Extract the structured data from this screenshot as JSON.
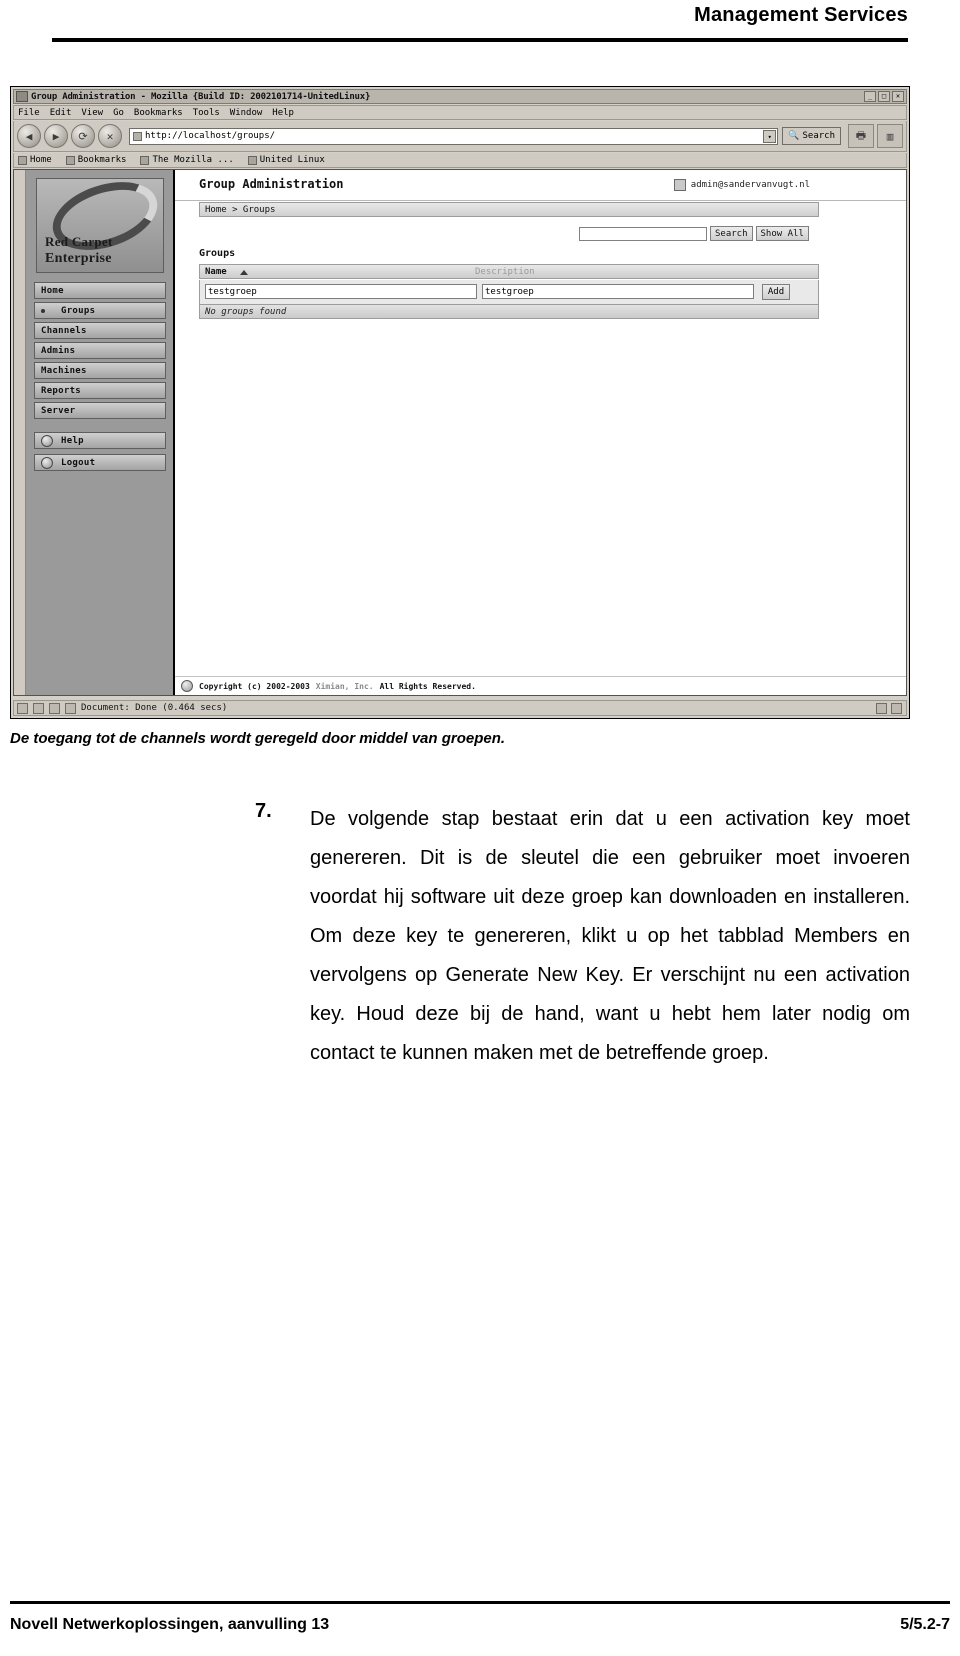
{
  "header": {
    "title": "Management Services"
  },
  "screenshot": {
    "window_title": "Group Administration - Mozilla {Build ID: 2002101714-UnitedLinux}",
    "window_buttons": [
      "_",
      "□",
      "✕"
    ],
    "menu": [
      "File",
      "Edit",
      "View",
      "Go",
      "Bookmarks",
      "Tools",
      "Window",
      "Help"
    ],
    "nav": {
      "back_icon": "back-arrow-icon",
      "forward_icon": "forward-arrow-icon",
      "reload_icon": "reload-icon",
      "stop_icon": "stop-icon",
      "url": "http://localhost/groups/",
      "search_button": "Search",
      "print_icon": "print-icon",
      "mozilla_logo": "mozilla-logo-icon"
    },
    "bookmarks": [
      "Home",
      "Bookmarks",
      "The Mozilla ...",
      "United Linux"
    ],
    "sidebar": {
      "logo_line1": "Red Carpet",
      "logo_line2": "Enterprise",
      "items": [
        {
          "label": "Home",
          "icon": "none"
        },
        {
          "label": "Groups",
          "icon": "bullet"
        },
        {
          "label": "Channels",
          "icon": "none"
        },
        {
          "label": "Admins",
          "icon": "none"
        },
        {
          "label": "Machines",
          "icon": "none"
        },
        {
          "label": "Reports",
          "icon": "none"
        },
        {
          "label": "Server",
          "icon": "none"
        },
        {
          "label": "Help",
          "icon": "circle"
        },
        {
          "label": "Logout",
          "icon": "circle"
        }
      ]
    },
    "app": {
      "title": "Group Administration",
      "user": "admin@sandervanvugt.nl",
      "breadcrumb": "Home > Groups",
      "search_value": "",
      "search_button": "Search",
      "show_all_button": "Show All",
      "panel_title": "Groups",
      "columns": [
        "Name",
        "Description"
      ],
      "row": {
        "name_value": "testgroep",
        "description_value": "testgroep",
        "add_button": "Add"
      },
      "empty_message": "No groups found",
      "copyright": "Copyright (c) 2002-2003",
      "copyright_company": "Ximian, Inc.",
      "copyright_rest": "All Rights Reserved."
    },
    "status": {
      "text": "Document: Done (0.464 secs)"
    }
  },
  "body": {
    "caption": "De toegang tot de channels wordt geregeld door middel van groepen.",
    "step_number": "7.",
    "step_text": "De volgende stap bestaat erin dat u een activation key moet genereren. Dit is de sleutel die een gebruiker moet invoeren voordat hij software uit deze groep kan downloaden en installeren. Om deze key te genereren, klikt u op het tabblad Members en vervolgens op Generate New Key. Er verschijnt nu een activation key. Houd deze bij de hand, want u hebt hem later nodig om contact te kunnen maken met de betreffende groep."
  },
  "footer": {
    "left": "Novell Netwerkoplossingen, aanvulling 13",
    "right": "5/5.2-7"
  }
}
